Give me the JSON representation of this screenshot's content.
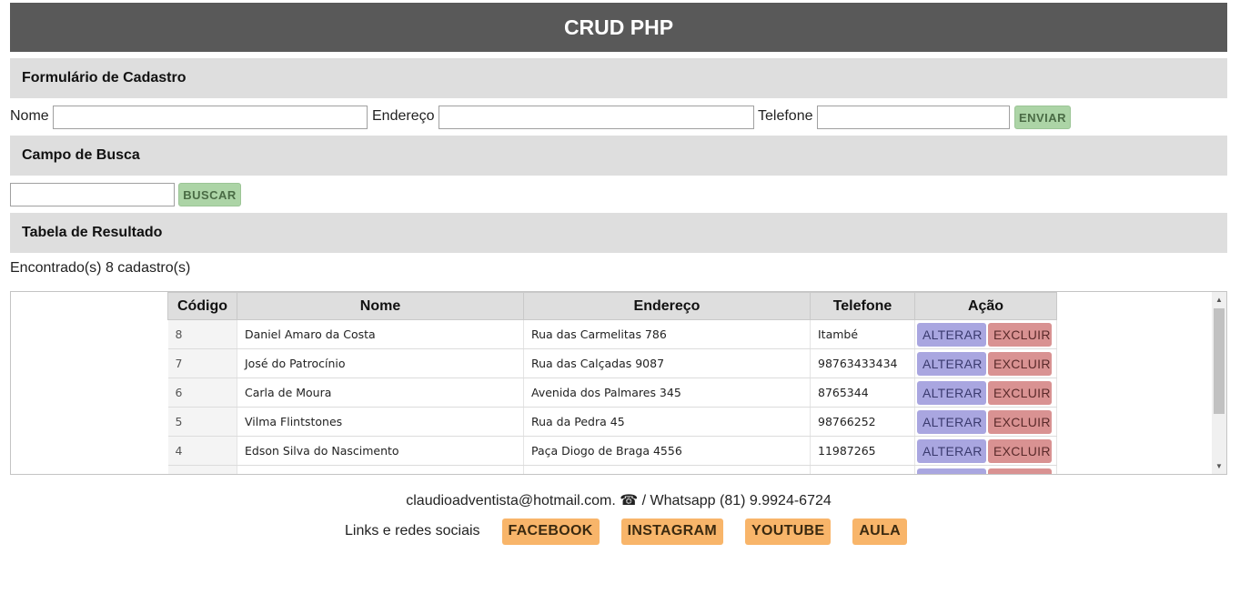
{
  "header": {
    "title": "CRUD PHP"
  },
  "form": {
    "section_title": "Formulário de Cadastro",
    "nome_label": "Nome",
    "nome_value": "",
    "endereco_label": "Endereço",
    "endereco_value": "",
    "telefone_label": "Telefone",
    "telefone_value": "",
    "submit_label": "ENVIAR"
  },
  "search": {
    "section_title": "Campo de Busca",
    "value": "",
    "button_label": "BUSCAR"
  },
  "results": {
    "section_title": "Tabela de Resultado",
    "count_text": "Encontrado(s) 8 cadastro(s)",
    "columns": [
      "Código",
      "Nome",
      "Endereço",
      "Telefone",
      "Ação"
    ],
    "rows": [
      {
        "codigo": "8",
        "nome": "Daniel Amaro da Costa",
        "endereco": "Rua das Carmelitas 786",
        "telefone": "Itambé"
      },
      {
        "codigo": "7",
        "nome": "José do Patrocínio",
        "endereco": "Rua das Calçadas 9087",
        "telefone": "98763433434"
      },
      {
        "codigo": "6",
        "nome": "Carla de Moura",
        "endereco": "Avenida dos Palmares 345",
        "telefone": "8765344"
      },
      {
        "codigo": "5",
        "nome": "Vilma Flintstones",
        "endereco": "Rua da Pedra 45",
        "telefone": "98766252"
      },
      {
        "codigo": "4",
        "nome": "Edson Silva do Nascimento",
        "endereco": "Paça Diogo de Braga 4556",
        "telefone": "11987265"
      },
      {
        "codigo": "",
        "nome": "",
        "endereco": "",
        "telefone": ""
      }
    ],
    "alterar_label": "ALTERAR",
    "excluir_label": "EXCLUIR"
  },
  "footer": {
    "contact_text": "claudioadventista@hotmail.com. ☎ / Whatsapp (81) 9.9924-6724",
    "links_label": "Links e redes sociais",
    "links": [
      "FACEBOOK",
      "INSTAGRAM",
      "YOUTUBE",
      "AULA"
    ]
  },
  "colors": {
    "header_bg": "#595959",
    "section_bg": "#dedede",
    "green_button": "#acd4a6",
    "alterar_button": "#a9a6e0",
    "excluir_button": "#d99292",
    "social_button": "#f8b56a"
  }
}
